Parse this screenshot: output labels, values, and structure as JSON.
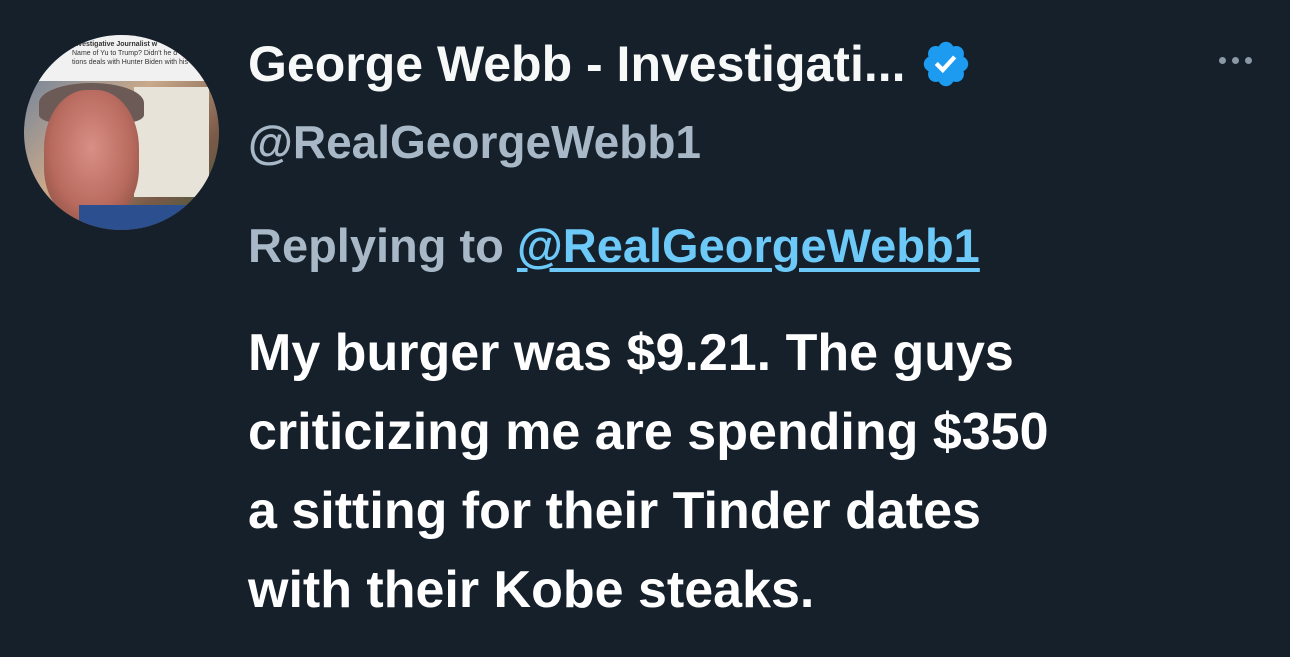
{
  "author": {
    "display_name": "George Webb - Investigati...",
    "handle": "@RealGeorgeWebb1",
    "verified": true,
    "avatar_caption": [
      "Investigative Journalist w",
      "Name of Yu to Trump? Didn't he d",
      "tions deals with Hunter Biden with his e"
    ]
  },
  "reply": {
    "prefix": "Replying to",
    "target": "@RealGeorgeWebb1"
  },
  "tweet": {
    "lines": [
      "My burger was $9.21. The guys",
      "criticizing me are spending $350",
      "a sitting for their Tinder dates",
      "with their Kobe steaks."
    ]
  },
  "icons": {
    "verified": "verified-badge-icon",
    "more": "more-options-icon"
  },
  "colors": {
    "background": "#15202b",
    "text": "#f7f9f9",
    "secondary": "#a8b8c7",
    "link": "#6cc9f8",
    "verified": "#1d9bf0"
  }
}
